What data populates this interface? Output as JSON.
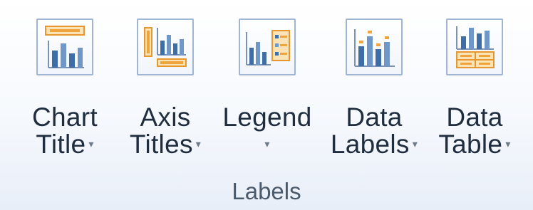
{
  "group": {
    "label": "Labels",
    "buttons": [
      {
        "id": "chart-title",
        "line1": "Chart",
        "line2": "Title",
        "icon": "chart-title-icon"
      },
      {
        "id": "axis-titles",
        "line1": "Axis",
        "line2": "Titles",
        "icon": "axis-titles-icon"
      },
      {
        "id": "legend",
        "line1": "Legend",
        "line2": "",
        "icon": "legend-icon"
      },
      {
        "id": "data-labels",
        "line1": "Data",
        "line2": "Labels",
        "icon": "data-labels-icon"
      },
      {
        "id": "data-table",
        "line1": "Data",
        "line2": "Table",
        "icon": "data-table-icon"
      }
    ],
    "dropdown_glyph": "▾"
  },
  "colors": {
    "bar_blue": "#3d6ea8",
    "accent_orange": "#f0a53c",
    "icon_border": "#9fb5d3",
    "text": "#1f2d3f"
  }
}
